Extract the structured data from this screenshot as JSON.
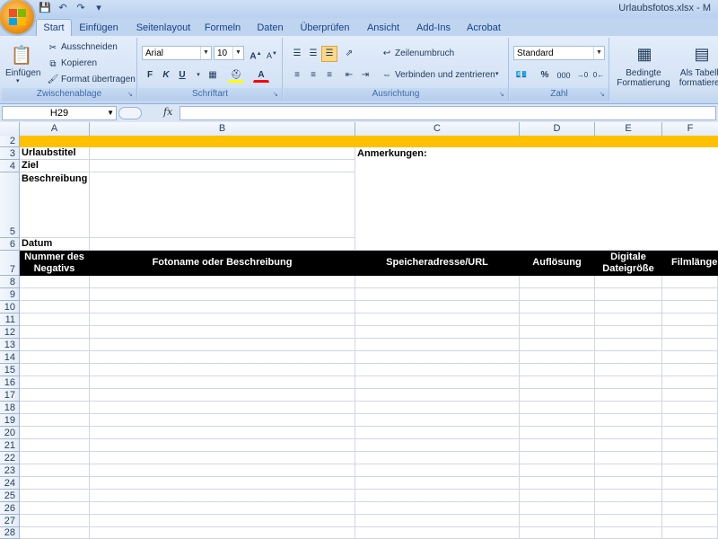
{
  "titlebar": {
    "title": "Urlaubsfotos.xlsx - M",
    "qat": [
      "save-icon",
      "undo-icon",
      "redo-icon",
      "customize-icon"
    ]
  },
  "tabs": [
    "Start",
    "Einfügen",
    "Seitenlayout",
    "Formeln",
    "Daten",
    "Überprüfen",
    "Ansicht",
    "Add-Ins",
    "Acrobat"
  ],
  "ribbon": {
    "clipboard": {
      "label": "Zwischenablage",
      "paste": "Einfügen",
      "cut": "Ausschneiden",
      "copy": "Kopieren",
      "format_painter": "Format übertragen"
    },
    "font": {
      "label": "Schriftart",
      "name": "Arial",
      "size": "10",
      "bold": "F",
      "italic": "K",
      "underline": "U"
    },
    "alignment": {
      "label": "Ausrichtung",
      "wrap": "Zeilenumbruch",
      "merge": "Verbinden und zentrieren"
    },
    "number": {
      "label": "Zahl",
      "format": "Standard",
      "percent": "%",
      "thousands": "000"
    },
    "styles": {
      "conditional": "Bedingte Formatierung",
      "as_table": "Als Tabelle formatieren"
    }
  },
  "formula_bar": {
    "name_box": "H29",
    "fx": "fx",
    "content": ""
  },
  "sheet": {
    "columns": [
      "A",
      "B",
      "C",
      "D",
      "E",
      "F"
    ],
    "rows": [
      "1",
      "2",
      "3",
      "4",
      "5",
      "6",
      "7",
      "8",
      "9",
      "10",
      "11",
      "12",
      "13",
      "14",
      "15",
      "16",
      "17",
      "18",
      "19",
      "20",
      "21",
      "22",
      "23",
      "24",
      "25",
      "26",
      "27",
      "28"
    ],
    "fields": {
      "trip_title": "Urlaubstitel",
      "destination": "Ziel",
      "description": "Beschreibung",
      "date": "Datum",
      "notes": "Anmerkungen:"
    },
    "table_headers": [
      "Nummer des Negativs",
      "Fotoname oder Beschreibung",
      "Speicheradresse/URL",
      "Auflösung",
      "Digitale Dateigröße",
      "Filmlänge"
    ],
    "accent_color": "#ffc000",
    "header_color": "#000000"
  }
}
